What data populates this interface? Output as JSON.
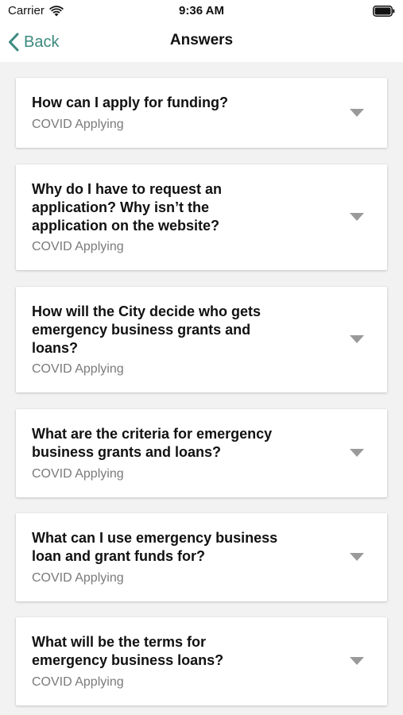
{
  "status_bar": {
    "carrier": "Carrier",
    "time": "9:36 AM"
  },
  "nav": {
    "back_label": "Back",
    "title": "Answers",
    "accent_color": "#3b8a7f"
  },
  "faq": {
    "items": [
      {
        "question": "How can I apply for funding?",
        "category": "COVID Applying"
      },
      {
        "question": "Why do I have to request an application? Why isn’t the application on the website?",
        "category": "COVID Applying"
      },
      {
        "question": "How will the City decide who gets emergency business grants and loans?",
        "category": "COVID Applying"
      },
      {
        "question": "What are the criteria for emergency business grants and loans?",
        "category": "COVID Applying"
      },
      {
        "question": "What can I use emergency business loan and grant funds for?",
        "category": "COVID Applying"
      },
      {
        "question": "What will be the terms for emergency business loans?",
        "category": "COVID Applying"
      }
    ]
  }
}
